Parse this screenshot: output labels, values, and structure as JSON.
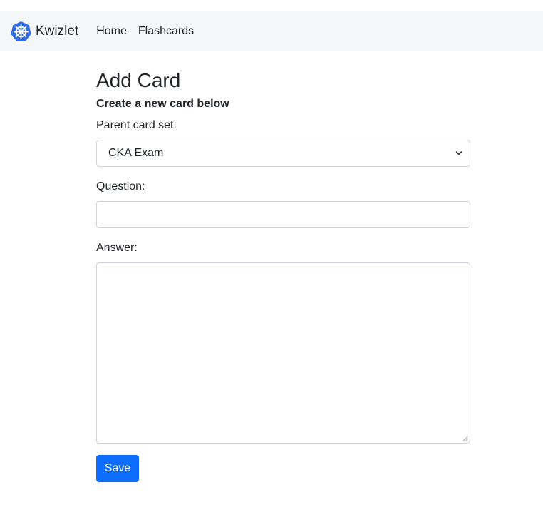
{
  "navbar": {
    "brand": "Kwizlet",
    "logo_icon": "helm-wheel-icon",
    "logo_color": "#326ce5",
    "links": [
      "Home",
      "Flashcards"
    ]
  },
  "page": {
    "title": "Add Card",
    "subtitle": "Create a new card below"
  },
  "form": {
    "parent_label": "Parent card set:",
    "parent_value": "CKA Exam",
    "question_label": "Question:",
    "question_value": "",
    "answer_label": "Answer:",
    "answer_value": "",
    "save_label": "Save"
  },
  "colors": {
    "primary": "#0d6efd",
    "navbar_bg": "#f5f6f8"
  }
}
